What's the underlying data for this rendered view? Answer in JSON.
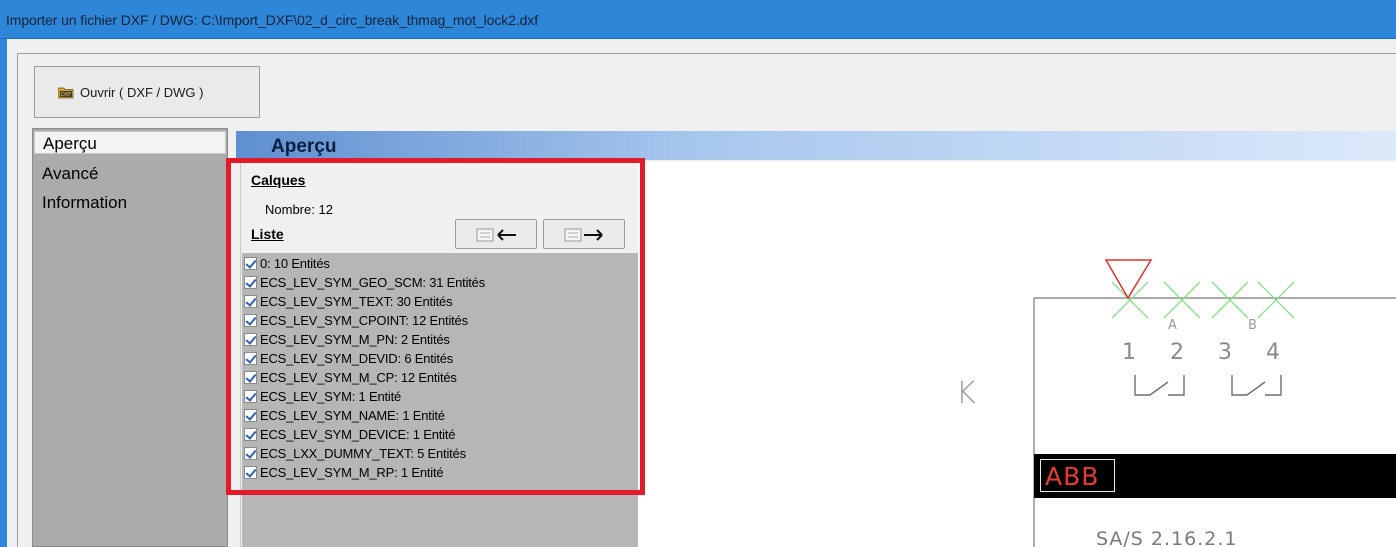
{
  "window": {
    "title": "Importer un fichier DXF / DWG: C:\\Import_DXF\\02_d_circ_break_thmag_mot_lock2.dxf"
  },
  "toolbar": {
    "open_label": "Ouvrir ( DXF / DWG )",
    "open_icon": "dxf-folder-icon"
  },
  "nav": {
    "items": [
      {
        "label": "Aperçu",
        "selected": true
      },
      {
        "label": "Avancé",
        "selected": false
      },
      {
        "label": "Information",
        "selected": false
      }
    ]
  },
  "content": {
    "header_title": "Aperçu"
  },
  "layers": {
    "heading": "Calques",
    "count_text": "Nombre: 12",
    "list_heading": "Liste",
    "prev_button_icon": "layers-arrow-left-icon",
    "next_button_icon": "layers-arrow-right-icon",
    "items": [
      {
        "label": "0: 10 Entités",
        "checked": true
      },
      {
        "label": "ECS_LEV_SYM_GEO_SCM: 31 Entités",
        "checked": true
      },
      {
        "label": "ECS_LEV_SYM_TEXT: 30 Entités",
        "checked": true
      },
      {
        "label": "ECS_LEV_SYM_CPOINT: 12 Entités",
        "checked": true
      },
      {
        "label": "ECS_LEV_SYM_M_PN: 2 Entités",
        "checked": true
      },
      {
        "label": "ECS_LEV_SYM_DEVID: 6 Entités",
        "checked": true
      },
      {
        "label": "ECS_LEV_SYM_M_CP: 12 Entités",
        "checked": true
      },
      {
        "label": "ECS_LEV_SYM: 1 Entité",
        "checked": true
      },
      {
        "label": "ECS_LEV_SYM_NAME: 1 Entité",
        "checked": true
      },
      {
        "label": "ECS_LEV_SYM_DEVICE: 1 Entité",
        "checked": true
      },
      {
        "label": "ECS_LXX_DUMMY_TEXT: 5 Entités",
        "checked": true
      },
      {
        "label": "ECS_LEV_SYM_M_RP: 1 Entité",
        "checked": true
      }
    ]
  },
  "preview": {
    "device_letter": "K",
    "pins": [
      "1",
      "2",
      "3",
      "4"
    ],
    "sub_labels": [
      "A",
      "B"
    ],
    "logo_text": "ABB",
    "reference": "SA/S 2.16.2.1"
  },
  "colors": {
    "title_bar": "#2e86d8",
    "highlight": "#e21b2b",
    "cross_marks": "#7ee07e",
    "marker": "#e23030"
  }
}
